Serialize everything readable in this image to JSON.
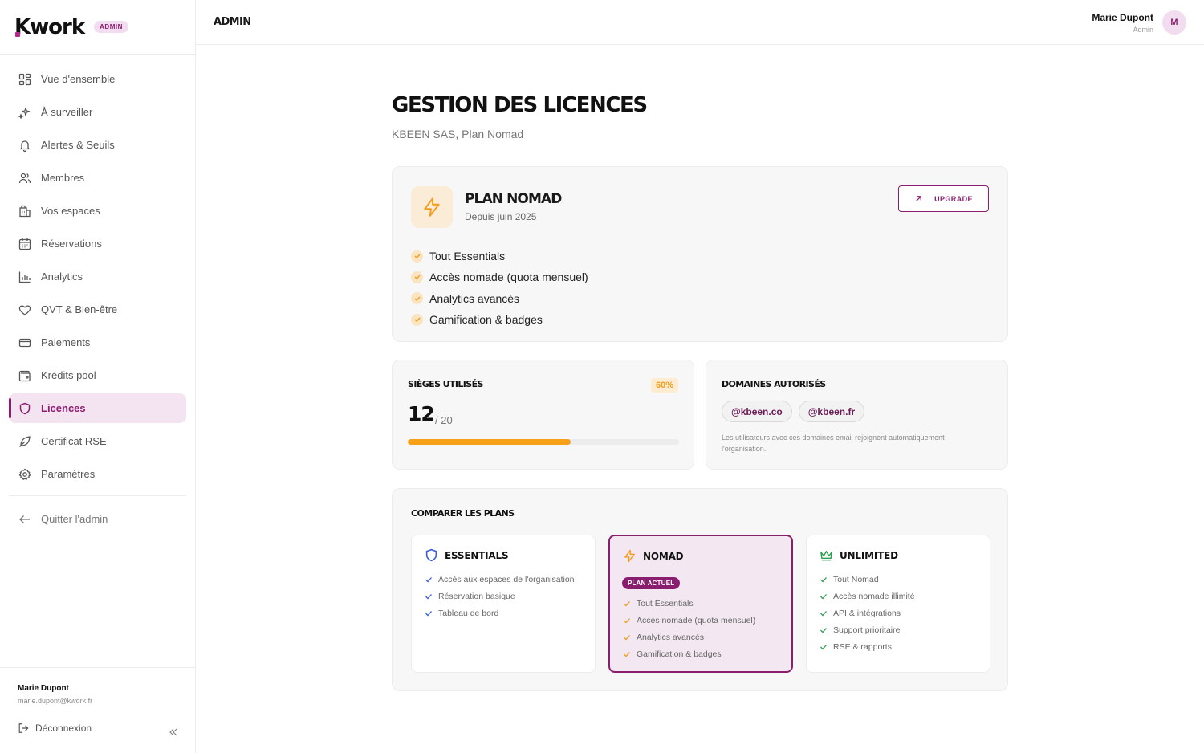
{
  "brand": {
    "name": "Kwork",
    "name_rest": "work",
    "name_first": "K",
    "badge": "ADMIN"
  },
  "nav": {
    "items": [
      {
        "id": "overview",
        "label": "Vue d'ensemble",
        "icon": "dashboard-icon"
      },
      {
        "id": "watch",
        "label": "À surveiller",
        "icon": "sparkle-icon"
      },
      {
        "id": "alerts",
        "label": "Alertes & Seuils",
        "icon": "bell-icon"
      },
      {
        "id": "members",
        "label": "Membres",
        "icon": "users-icon"
      },
      {
        "id": "spaces",
        "label": "Vos espaces",
        "icon": "building-icon"
      },
      {
        "id": "bookings",
        "label": "Réservations",
        "icon": "calendar-icon"
      },
      {
        "id": "analytics",
        "label": "Analytics",
        "icon": "bar-chart-icon"
      },
      {
        "id": "wellbeing",
        "label": "QVT & Bien-être",
        "icon": "heart-icon"
      },
      {
        "id": "payments",
        "label": "Paiements",
        "icon": "credit-card-icon"
      },
      {
        "id": "credits",
        "label": "Krédits pool",
        "icon": "wallet-icon"
      },
      {
        "id": "licences",
        "label": "Licences",
        "icon": "shield-icon",
        "active": true
      },
      {
        "id": "csr",
        "label": "Certificat RSE",
        "icon": "leaf-icon"
      },
      {
        "id": "settings",
        "label": "Paramètres",
        "icon": "gear-icon"
      }
    ],
    "quit_label": "Quitter l'admin"
  },
  "sidebar_footer": {
    "name": "Marie Dupont",
    "email": "marie.dupont@kwork.fr",
    "logout_label": "Déconnexion"
  },
  "topbar": {
    "crumb": "ADMIN",
    "user_name": "Marie Dupont",
    "user_role": "Admin",
    "avatar_initial": "M"
  },
  "page": {
    "title": "GESTION DES LICENCES",
    "subtitle": "KBEEN SAS, Plan Nomad"
  },
  "plan": {
    "name": "PLAN NOMAD",
    "since": "Depuis juin 2025",
    "upgrade_label": "UPGRADE",
    "features": [
      "Tout Essentials",
      "Accès nomade (quota mensuel)",
      "Analytics avancés",
      "Gamification & badges"
    ]
  },
  "seats": {
    "label": "SIÈGES UTILISÉS",
    "used": "12",
    "total": "/ 20",
    "percent_label": "60%",
    "fill_fraction": 0.6
  },
  "domains": {
    "label": "DOMAINES AUTORISÉS",
    "list": [
      "@kbeen.co",
      "@kbeen.fr"
    ],
    "note": "Les utilisateurs avec ces domaines email rejoignent automatiquement l'organisation."
  },
  "compare": {
    "label": "COMPARER LES PLANS",
    "current_badge": "PLAN ACTUEL",
    "tiers": [
      {
        "name": "ESSENTIALS",
        "icon": "shield-icon",
        "features": [
          "Accès aux espaces de l'organisation",
          "Réservation basique",
          "Tableau de bord"
        ]
      },
      {
        "name": "NOMAD",
        "icon": "lightning-icon",
        "current": true,
        "features": [
          "Tout Essentials",
          "Accès nomade (quota mensuel)",
          "Analytics avancés",
          "Gamification & badges"
        ]
      },
      {
        "name": "UNLIMITED",
        "icon": "crown-icon",
        "features": [
          "Tout Nomad",
          "Accès nomade illimité",
          "API & intégrations",
          "Support prioritaire",
          "RSE & rapports"
        ]
      }
    ]
  },
  "colors": {
    "accent": "#8a1e6e",
    "accent_soft": "#f4e4f1",
    "orange": "#f7a11a",
    "green": "#2e9e4f",
    "blue": "#3b5bdb"
  }
}
